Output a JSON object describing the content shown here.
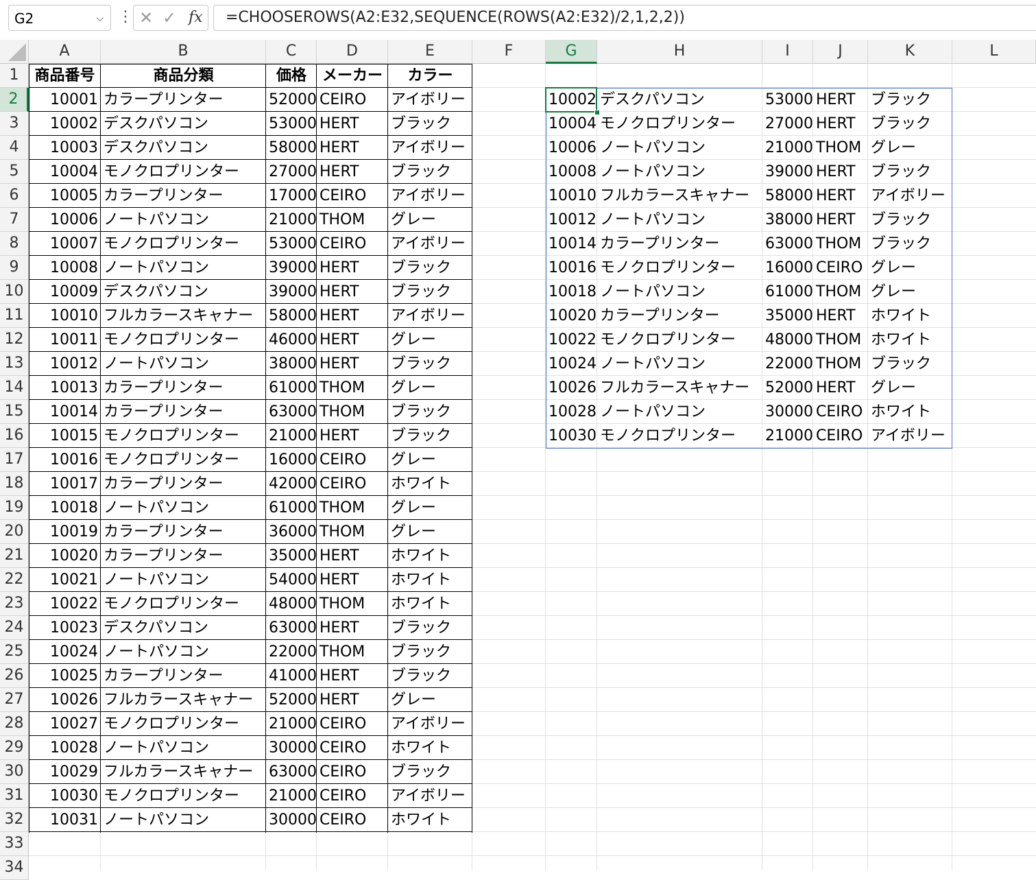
{
  "formula_bar": {
    "name_box": "G2",
    "formula": "=CHOOSEROWS(A2:E32,SEQUENCE(ROWS(A2:E32)/2,1,2,2))",
    "cancel_icon": "x-icon",
    "enter_icon": "check-icon",
    "fx_label": "fx"
  },
  "columns": [
    "A",
    "B",
    "C",
    "D",
    "E",
    "F",
    "G",
    "H",
    "I",
    "J",
    "K",
    "L"
  ],
  "rows": [
    "1",
    "2",
    "3",
    "4",
    "5",
    "6",
    "7",
    "8",
    "9",
    "10",
    "11",
    "12",
    "13",
    "14",
    "15",
    "16",
    "17",
    "18",
    "19",
    "20",
    "21",
    "22",
    "23",
    "24",
    "25",
    "26",
    "27",
    "28",
    "29",
    "30",
    "31",
    "32",
    "33",
    "34"
  ],
  "selected": {
    "column": "G",
    "row": "2"
  },
  "source_table": {
    "headers": [
      "商品番号",
      "商品分類",
      "価格",
      "メーカー",
      "カラー"
    ],
    "rows": [
      [
        "10001",
        "カラープリンター",
        "52000",
        "CEIRO",
        "アイボリー"
      ],
      [
        "10002",
        "デスクパソコン",
        "53000",
        "HERT",
        "ブラック"
      ],
      [
        "10003",
        "デスクパソコン",
        "58000",
        "HERT",
        "アイボリー"
      ],
      [
        "10004",
        "モノクロプリンター",
        "27000",
        "HERT",
        "ブラック"
      ],
      [
        "10005",
        "カラープリンター",
        "17000",
        "CEIRO",
        "アイボリー"
      ],
      [
        "10006",
        "ノートパソコン",
        "21000",
        "THOM",
        "グレー"
      ],
      [
        "10007",
        "モノクロプリンター",
        "53000",
        "CEIRO",
        "アイボリー"
      ],
      [
        "10008",
        "ノートパソコン",
        "39000",
        "HERT",
        "ブラック"
      ],
      [
        "10009",
        "デスクパソコン",
        "39000",
        "HERT",
        "ブラック"
      ],
      [
        "10010",
        "フルカラースキャナー",
        "58000",
        "HERT",
        "アイボリー"
      ],
      [
        "10011",
        "モノクロプリンター",
        "46000",
        "HERT",
        "グレー"
      ],
      [
        "10012",
        "ノートパソコン",
        "38000",
        "HERT",
        "ブラック"
      ],
      [
        "10013",
        "カラープリンター",
        "61000",
        "THOM",
        "グレー"
      ],
      [
        "10014",
        "カラープリンター",
        "63000",
        "THOM",
        "ブラック"
      ],
      [
        "10015",
        "モノクロプリンター",
        "21000",
        "HERT",
        "ブラック"
      ],
      [
        "10016",
        "モノクロプリンター",
        "16000",
        "CEIRO",
        "グレー"
      ],
      [
        "10017",
        "カラープリンター",
        "42000",
        "CEIRO",
        "ホワイト"
      ],
      [
        "10018",
        "ノートパソコン",
        "61000",
        "THOM",
        "グレー"
      ],
      [
        "10019",
        "カラープリンター",
        "36000",
        "THOM",
        "グレー"
      ],
      [
        "10020",
        "カラープリンター",
        "35000",
        "HERT",
        "ホワイト"
      ],
      [
        "10021",
        "ノートパソコン",
        "54000",
        "HERT",
        "ホワイト"
      ],
      [
        "10022",
        "モノクロプリンター",
        "48000",
        "THOM",
        "ホワイト"
      ],
      [
        "10023",
        "デスクパソコン",
        "63000",
        "HERT",
        "ブラック"
      ],
      [
        "10024",
        "ノートパソコン",
        "22000",
        "THOM",
        "ブラック"
      ],
      [
        "10025",
        "カラープリンター",
        "41000",
        "HERT",
        "ブラック"
      ],
      [
        "10026",
        "フルカラースキャナー",
        "52000",
        "HERT",
        "グレー"
      ],
      [
        "10027",
        "モノクロプリンター",
        "21000",
        "CEIRO",
        "アイボリー"
      ],
      [
        "10028",
        "ノートパソコン",
        "30000",
        "CEIRO",
        "ホワイト"
      ],
      [
        "10029",
        "フルカラースキャナー",
        "63000",
        "CEIRO",
        "ブラック"
      ],
      [
        "10030",
        "モノクロプリンター",
        "21000",
        "CEIRO",
        "アイボリー"
      ],
      [
        "10031",
        "ノートパソコン",
        "30000",
        "CEIRO",
        "ホワイト"
      ]
    ]
  },
  "result_table": {
    "rows": [
      [
        "10002",
        "デスクパソコン",
        "53000",
        "HERT",
        "ブラック"
      ],
      [
        "10004",
        "モノクロプリンター",
        "27000",
        "HERT",
        "ブラック"
      ],
      [
        "10006",
        "ノートパソコン",
        "21000",
        "THOM",
        "グレー"
      ],
      [
        "10008",
        "ノートパソコン",
        "39000",
        "HERT",
        "ブラック"
      ],
      [
        "10010",
        "フルカラースキャナー",
        "58000",
        "HERT",
        "アイボリー"
      ],
      [
        "10012",
        "ノートパソコン",
        "38000",
        "HERT",
        "ブラック"
      ],
      [
        "10014",
        "カラープリンター",
        "63000",
        "THOM",
        "ブラック"
      ],
      [
        "10016",
        "モノクロプリンター",
        "16000",
        "CEIRO",
        "グレー"
      ],
      [
        "10018",
        "ノートパソコン",
        "61000",
        "THOM",
        "グレー"
      ],
      [
        "10020",
        "カラープリンター",
        "35000",
        "HERT",
        "ホワイト"
      ],
      [
        "10022",
        "モノクロプリンター",
        "48000",
        "THOM",
        "ホワイト"
      ],
      [
        "10024",
        "ノートパソコン",
        "22000",
        "THOM",
        "ブラック"
      ],
      [
        "10026",
        "フルカラースキャナー",
        "52000",
        "HERT",
        "グレー"
      ],
      [
        "10028",
        "ノートパソコン",
        "30000",
        "CEIRO",
        "ホワイト"
      ],
      [
        "10030",
        "モノクロプリンター",
        "21000",
        "CEIRO",
        "アイボリー"
      ]
    ]
  },
  "colors": {
    "selection_green": "#107c41",
    "spill_border": "#4472c4",
    "header_bg": "#f3f3f3"
  }
}
